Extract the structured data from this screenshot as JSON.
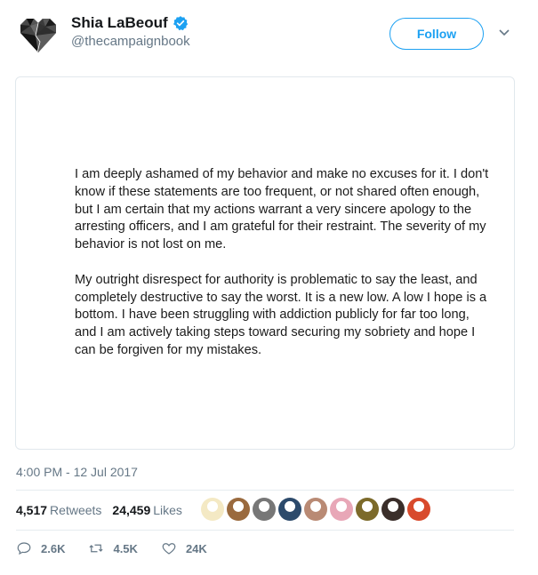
{
  "user": {
    "display_name": "Shia LaBeouf",
    "handle": "@thecampaignbook",
    "verified": true
  },
  "follow_button": {
    "label": "Follow"
  },
  "statement": {
    "paragraphs": [
      "I am deeply ashamed of my behavior and make no excuses for it. I don't know if these statements are too frequent, or not shared often enough, but I am certain that my actions warrant a very sincere apology to the arresting officers, and I am grateful for their restraint. The severity of my behavior is not lost on me.",
      "My outright disrespect for authority is problematic to say the least, and completely destructive to say the worst. It is a new low. A low I hope is a bottom. I have been struggling with addiction publicly for far too long, and I am actively taking steps toward securing my sobriety and hope I can be forgiven for my mistakes."
    ]
  },
  "timestamp": "4:00 PM - 12 Jul 2017",
  "stats": {
    "retweets_count": "4,517",
    "retweets_label": "Retweets",
    "likes_count": "24,459",
    "likes_label": "Likes"
  },
  "liker_avatars": [
    {
      "color": "#f4e9c4"
    },
    {
      "color": "#9a6a3e"
    },
    {
      "color": "#777777"
    },
    {
      "color": "#2c4a6b"
    },
    {
      "color": "#b98a74"
    },
    {
      "color": "#e8a7b7"
    },
    {
      "color": "#7c6a2a"
    },
    {
      "color": "#3a2e2a"
    },
    {
      "color": "#d84a2c"
    }
  ],
  "actions": {
    "reply_count": "2.6K",
    "retweet_count": "4.5K",
    "like_count": "24K"
  },
  "colors": {
    "accent": "#1da1f2",
    "muted": "#657786",
    "text": "#14171a"
  },
  "icons": [
    "broken-heart-avatar-icon",
    "verified-badge-icon",
    "chevron-down-icon",
    "reply-icon",
    "retweet-icon",
    "like-icon"
  ]
}
